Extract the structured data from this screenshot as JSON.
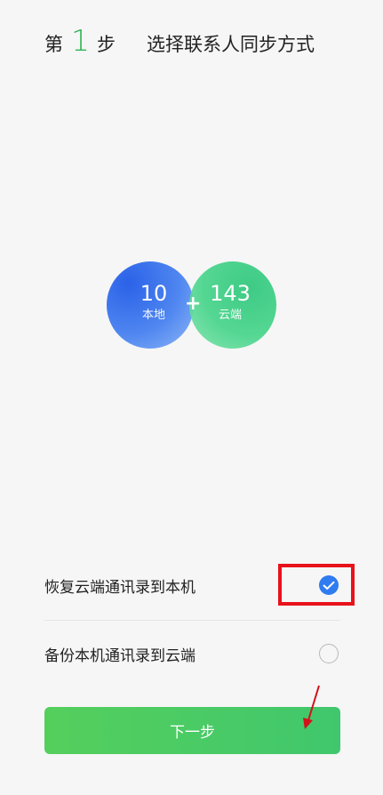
{
  "header": {
    "step_prefix": "第",
    "step_number": "1",
    "step_suffix": "步",
    "title": "选择联系人同步方式"
  },
  "venn": {
    "local": {
      "count": "10",
      "label": "本地",
      "color": "#2b62e8"
    },
    "plus": "+",
    "cloud": {
      "count": "143",
      "label": "云端",
      "color": "#2ec77b"
    }
  },
  "options": [
    {
      "label": "恢复云端通讯录到本机",
      "selected": true,
      "icon": "check-icon"
    },
    {
      "label": "备份本机通讯录到云端",
      "selected": false,
      "icon": "radio-empty-icon"
    }
  ],
  "next_button": {
    "label": "下一步",
    "color": "#4ccb62"
  },
  "annotations": {
    "highlight_color": "#e8121b",
    "arrow_color": "#d4101a"
  }
}
